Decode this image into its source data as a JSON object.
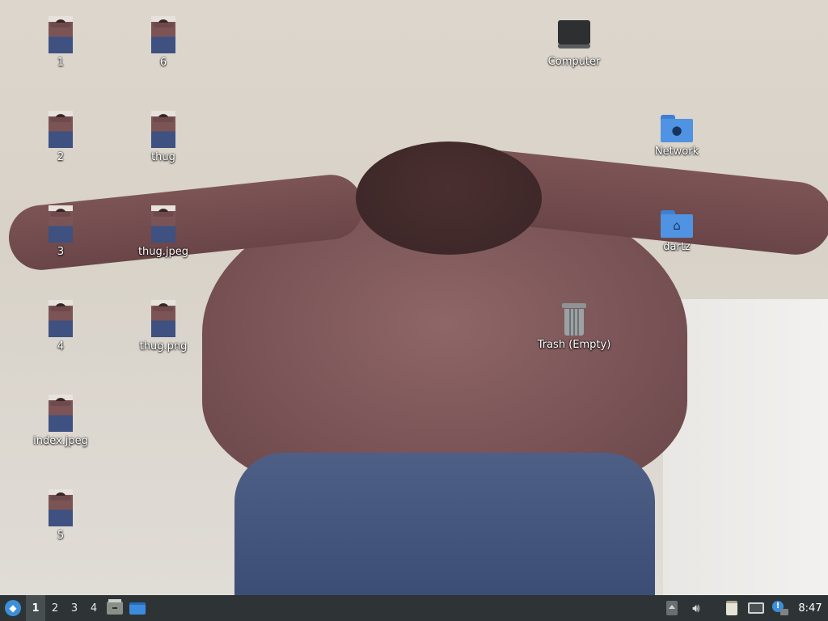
{
  "desktop": {
    "icons_left": [
      {
        "label": "1"
      },
      {
        "label": "2"
      },
      {
        "label": "3"
      },
      {
        "label": "4"
      },
      {
        "label": "index.jpeg"
      },
      {
        "label": "5"
      }
    ],
    "icons_second": [
      {
        "label": "6"
      },
      {
        "label": "thug"
      },
      {
        "label": "thug.jpeg"
      },
      {
        "label": "thug.png"
      }
    ],
    "system_icons": {
      "computer": "Computer",
      "network": "Network",
      "home": "dartz",
      "trash": "Trash (Empty)"
    }
  },
  "taskbar": {
    "workspaces": [
      "1",
      "2",
      "3",
      "4"
    ],
    "active_workspace": "1",
    "clock": "8:47",
    "icons": [
      "start-menu-icon",
      "file-manager-icon",
      "window-icon",
      "eject-icon",
      "volume-icon",
      "clipboard-icon",
      "network-icon",
      "update-notifier-icon"
    ]
  },
  "colors": {
    "taskbar_bg": "#2e3436",
    "folder_blue": "#4f93e2",
    "start_blue": "#3c8fd8"
  }
}
